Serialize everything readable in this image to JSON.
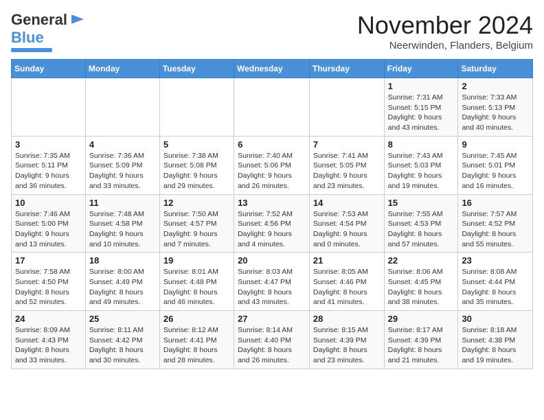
{
  "header": {
    "logo_general": "General",
    "logo_blue": "Blue",
    "month_title": "November 2024",
    "location": "Neerwinden, Flanders, Belgium"
  },
  "weekdays": [
    "Sunday",
    "Monday",
    "Tuesday",
    "Wednesday",
    "Thursday",
    "Friday",
    "Saturday"
  ],
  "weeks": [
    [
      {
        "day": "",
        "info": ""
      },
      {
        "day": "",
        "info": ""
      },
      {
        "day": "",
        "info": ""
      },
      {
        "day": "",
        "info": ""
      },
      {
        "day": "",
        "info": ""
      },
      {
        "day": "1",
        "info": "Sunrise: 7:31 AM\nSunset: 5:15 PM\nDaylight: 9 hours and 43 minutes."
      },
      {
        "day": "2",
        "info": "Sunrise: 7:33 AM\nSunset: 5:13 PM\nDaylight: 9 hours and 40 minutes."
      }
    ],
    [
      {
        "day": "3",
        "info": "Sunrise: 7:35 AM\nSunset: 5:11 PM\nDaylight: 9 hours and 36 minutes."
      },
      {
        "day": "4",
        "info": "Sunrise: 7:36 AM\nSunset: 5:09 PM\nDaylight: 9 hours and 33 minutes."
      },
      {
        "day": "5",
        "info": "Sunrise: 7:38 AM\nSunset: 5:08 PM\nDaylight: 9 hours and 29 minutes."
      },
      {
        "day": "6",
        "info": "Sunrise: 7:40 AM\nSunset: 5:06 PM\nDaylight: 9 hours and 26 minutes."
      },
      {
        "day": "7",
        "info": "Sunrise: 7:41 AM\nSunset: 5:05 PM\nDaylight: 9 hours and 23 minutes."
      },
      {
        "day": "8",
        "info": "Sunrise: 7:43 AM\nSunset: 5:03 PM\nDaylight: 9 hours and 19 minutes."
      },
      {
        "day": "9",
        "info": "Sunrise: 7:45 AM\nSunset: 5:01 PM\nDaylight: 9 hours and 16 minutes."
      }
    ],
    [
      {
        "day": "10",
        "info": "Sunrise: 7:46 AM\nSunset: 5:00 PM\nDaylight: 9 hours and 13 minutes."
      },
      {
        "day": "11",
        "info": "Sunrise: 7:48 AM\nSunset: 4:58 PM\nDaylight: 9 hours and 10 minutes."
      },
      {
        "day": "12",
        "info": "Sunrise: 7:50 AM\nSunset: 4:57 PM\nDaylight: 9 hours and 7 minutes."
      },
      {
        "day": "13",
        "info": "Sunrise: 7:52 AM\nSunset: 4:56 PM\nDaylight: 9 hours and 4 minutes."
      },
      {
        "day": "14",
        "info": "Sunrise: 7:53 AM\nSunset: 4:54 PM\nDaylight: 9 hours and 0 minutes."
      },
      {
        "day": "15",
        "info": "Sunrise: 7:55 AM\nSunset: 4:53 PM\nDaylight: 8 hours and 57 minutes."
      },
      {
        "day": "16",
        "info": "Sunrise: 7:57 AM\nSunset: 4:52 PM\nDaylight: 8 hours and 55 minutes."
      }
    ],
    [
      {
        "day": "17",
        "info": "Sunrise: 7:58 AM\nSunset: 4:50 PM\nDaylight: 8 hours and 52 minutes."
      },
      {
        "day": "18",
        "info": "Sunrise: 8:00 AM\nSunset: 4:49 PM\nDaylight: 8 hours and 49 minutes."
      },
      {
        "day": "19",
        "info": "Sunrise: 8:01 AM\nSunset: 4:48 PM\nDaylight: 8 hours and 46 minutes."
      },
      {
        "day": "20",
        "info": "Sunrise: 8:03 AM\nSunset: 4:47 PM\nDaylight: 8 hours and 43 minutes."
      },
      {
        "day": "21",
        "info": "Sunrise: 8:05 AM\nSunset: 4:46 PM\nDaylight: 8 hours and 41 minutes."
      },
      {
        "day": "22",
        "info": "Sunrise: 8:06 AM\nSunset: 4:45 PM\nDaylight: 8 hours and 38 minutes."
      },
      {
        "day": "23",
        "info": "Sunrise: 8:08 AM\nSunset: 4:44 PM\nDaylight: 8 hours and 35 minutes."
      }
    ],
    [
      {
        "day": "24",
        "info": "Sunrise: 8:09 AM\nSunset: 4:43 PM\nDaylight: 8 hours and 33 minutes."
      },
      {
        "day": "25",
        "info": "Sunrise: 8:11 AM\nSunset: 4:42 PM\nDaylight: 8 hours and 30 minutes."
      },
      {
        "day": "26",
        "info": "Sunrise: 8:12 AM\nSunset: 4:41 PM\nDaylight: 8 hours and 28 minutes."
      },
      {
        "day": "27",
        "info": "Sunrise: 8:14 AM\nSunset: 4:40 PM\nDaylight: 8 hours and 26 minutes."
      },
      {
        "day": "28",
        "info": "Sunrise: 8:15 AM\nSunset: 4:39 PM\nDaylight: 8 hours and 23 minutes."
      },
      {
        "day": "29",
        "info": "Sunrise: 8:17 AM\nSunset: 4:39 PM\nDaylight: 8 hours and 21 minutes."
      },
      {
        "day": "30",
        "info": "Sunrise: 8:18 AM\nSunset: 4:38 PM\nDaylight: 8 hours and 19 minutes."
      }
    ]
  ]
}
